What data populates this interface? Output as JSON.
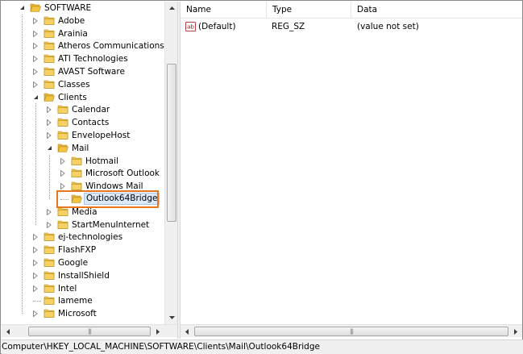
{
  "tree": {
    "items": [
      {
        "label": "SOFTWARE",
        "level": 0,
        "state": "expanded"
      },
      {
        "label": "Adobe",
        "level": 1,
        "state": "collapsed"
      },
      {
        "label": "Arainia",
        "level": 1,
        "state": "collapsed"
      },
      {
        "label": "Atheros Communications Inc",
        "level": 1,
        "state": "collapsed"
      },
      {
        "label": "ATI Technologies",
        "level": 1,
        "state": "collapsed"
      },
      {
        "label": "AVAST Software",
        "level": 1,
        "state": "collapsed"
      },
      {
        "label": "Classes",
        "level": 1,
        "state": "collapsed"
      },
      {
        "label": "Clients",
        "level": 1,
        "state": "expanded"
      },
      {
        "label": "Calendar",
        "level": 2,
        "state": "collapsed"
      },
      {
        "label": "Contacts",
        "level": 2,
        "state": "collapsed"
      },
      {
        "label": "EnvelopeHost",
        "level": 2,
        "state": "collapsed"
      },
      {
        "label": "Mail",
        "level": 2,
        "state": "expanded"
      },
      {
        "label": "Hotmail",
        "level": 3,
        "state": "collapsed"
      },
      {
        "label": "Microsoft Outlook",
        "level": 3,
        "state": "collapsed"
      },
      {
        "label": "Windows Mail",
        "level": 3,
        "state": "collapsed"
      },
      {
        "label": "Outlook64Bridge",
        "level": 3,
        "state": "leaf",
        "selected": true
      },
      {
        "label": "Media",
        "level": 2,
        "state": "collapsed"
      },
      {
        "label": "StartMenuInternet",
        "level": 2,
        "state": "collapsed"
      },
      {
        "label": "ej-technologies",
        "level": 1,
        "state": "collapsed"
      },
      {
        "label": "FlashFXP",
        "level": 1,
        "state": "collapsed"
      },
      {
        "label": "Google",
        "level": 1,
        "state": "collapsed"
      },
      {
        "label": "InstallShield",
        "level": 1,
        "state": "collapsed"
      },
      {
        "label": "Intel",
        "level": 1,
        "state": "collapsed"
      },
      {
        "label": "lameme",
        "level": 1,
        "state": "leaf"
      },
      {
        "label": "Microsoft",
        "level": 1,
        "state": "collapsed"
      }
    ]
  },
  "values": {
    "columns": [
      "Name",
      "Type",
      "Data"
    ],
    "rows": [
      {
        "icon": "string-value-icon",
        "icon_text": "ab",
        "name": "(Default)",
        "type": "REG_SZ",
        "data": "(value not set)"
      }
    ]
  },
  "status_bar": {
    "path": "Computer\\HKEY_LOCAL_MACHINE\\SOFTWARE\\Clients\\Mail\\Outlook64Bridge"
  },
  "colors": {
    "highlight_outline": "#e9771e",
    "selection_fill": "#dce9f9",
    "folder_yellow": "#f2c443"
  },
  "icons": {
    "folder": "folder-icon",
    "expand": "expand-arrow-icon",
    "collapse": "collapse-arrow-icon",
    "scroll_up": "scroll-up-arrow-icon",
    "scroll_down": "scroll-down-arrow-icon",
    "scroll_left": "scroll-left-arrow-icon",
    "scroll_right": "scroll-right-arrow-icon"
  }
}
